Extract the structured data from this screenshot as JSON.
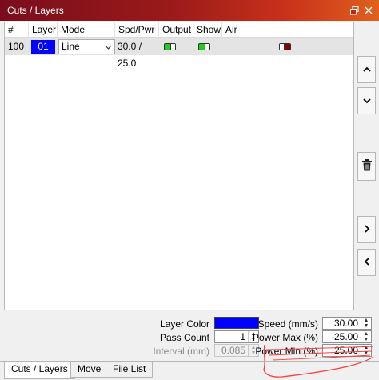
{
  "window": {
    "title": "Cuts / Layers"
  },
  "table": {
    "headers": [
      "#",
      "Layer",
      "Mode",
      "Spd/Pwr",
      "Output",
      "Show",
      "Air"
    ],
    "rows": [
      {
        "number": "100",
        "layer": "01",
        "layer_color": "#0000ff",
        "mode": "Line",
        "spd_pwr": "30.0 / 25.0",
        "output": true,
        "show": true,
        "air": false
      }
    ]
  },
  "side_buttons": [
    "move-up",
    "move-down",
    "delete",
    "next",
    "previous"
  ],
  "properties": {
    "layer_color_label": "Layer Color",
    "layer_color": "#0000ff",
    "pass_count_label": "Pass Count",
    "pass_count": "1",
    "interval_label": "Interval (mm)",
    "interval": "0.085",
    "speed_label": "Speed (mm/s)",
    "speed": "30.00",
    "power_max_label": "Power Max (%)",
    "power_max": "25.00",
    "power_min_label": "Power Min (%)",
    "power_min": "25.00"
  },
  "tabs": [
    "Cuts / Layers",
    "Move",
    "File List"
  ],
  "colors": {
    "toggle_on": "#22cc22",
    "toggle_off": "#8b0000",
    "scribble": "#ff3b3b"
  }
}
